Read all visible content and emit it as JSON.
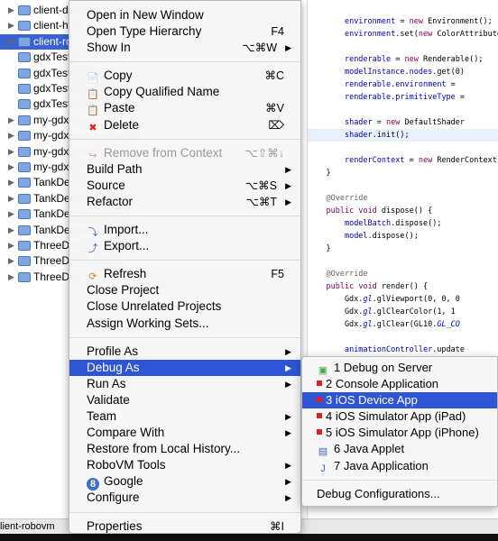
{
  "tree": {
    "items": [
      {
        "label": "client-desktop",
        "arrow": true
      },
      {
        "label": "client-html",
        "arrow": true
      },
      {
        "label": "client-robovm",
        "arrow": true,
        "selected": true
      },
      {
        "label": "gdxTests",
        "arrow": false
      },
      {
        "label": "gdxTests-android",
        "arrow": false
      },
      {
        "label": "gdxTests-desktop",
        "arrow": false
      },
      {
        "label": "gdxTests-html",
        "arrow": false
      },
      {
        "label": "my-gdx-game",
        "arrow": true
      },
      {
        "label": "my-gdx-game-android",
        "arrow": true
      },
      {
        "label": "my-gdx-game-desktop",
        "arrow": true
      },
      {
        "label": "my-gdx-game-html",
        "arrow": true
      },
      {
        "label": "TankDemo",
        "arrow": true
      },
      {
        "label": "TankDemo-android",
        "arrow": true
      },
      {
        "label": "TankDemo-desktop",
        "arrow": true
      },
      {
        "label": "TankDemo-html",
        "arrow": true
      },
      {
        "label": "ThreeDee",
        "arrow": true
      },
      {
        "label": "ThreeDee-android",
        "arrow": true
      },
      {
        "label": "ThreeDee-desktop",
        "arrow": true
      }
    ]
  },
  "editor": {
    "lines": [
      [],
      [
        {
          "t": "        "
        },
        {
          "t": "environment",
          "c": "f"
        },
        {
          "t": " = "
        },
        {
          "t": "new",
          "c": "k"
        },
        {
          "t": " Environment();"
        }
      ],
      [
        {
          "t": "        "
        },
        {
          "t": "environment",
          "c": "f"
        },
        {
          "t": ".set("
        },
        {
          "t": "new",
          "c": "k"
        },
        {
          "t": " ColorAttribute"
        }
      ],
      [],
      [
        {
          "t": "        "
        },
        {
          "t": "renderable",
          "c": "f"
        },
        {
          "t": " = "
        },
        {
          "t": "new",
          "c": "k"
        },
        {
          "t": " Renderable();"
        }
      ],
      [
        {
          "t": "        "
        },
        {
          "t": "modelInstance",
          "c": "f"
        },
        {
          "t": "."
        },
        {
          "t": "nodes",
          "c": "f"
        },
        {
          "t": ".get(0)"
        }
      ],
      [
        {
          "t": "        "
        },
        {
          "t": "renderable",
          "c": "f"
        },
        {
          "t": "."
        },
        {
          "t": "environment",
          "c": "f"
        },
        {
          "t": " = "
        }
      ],
      [
        {
          "t": "        "
        },
        {
          "t": "renderable",
          "c": "f"
        },
        {
          "t": "."
        },
        {
          "t": "primitiveType",
          "c": "f"
        },
        {
          "t": " ="
        }
      ],
      [],
      [
        {
          "t": "        "
        },
        {
          "t": "shader",
          "c": "f"
        },
        {
          "t": " = "
        },
        {
          "t": "new",
          "c": "k"
        },
        {
          "t": " DefaultShader"
        }
      ],
      [
        {
          "t": "        "
        },
        {
          "t": "shader",
          "c": "f"
        },
        {
          "t": ".init();"
        }
      ],
      [],
      [
        {
          "t": "        "
        },
        {
          "t": "renderContext",
          "c": "f"
        },
        {
          "t": " = "
        },
        {
          "t": "new",
          "c": "k"
        },
        {
          "t": " RenderContext"
        }
      ],
      [
        {
          "t": "    }"
        }
      ],
      [],
      [
        {
          "t": "    "
        },
        {
          "t": "@Override",
          "c": "a"
        }
      ],
      [
        {
          "t": "    "
        },
        {
          "t": "public",
          "c": "k"
        },
        {
          "t": " "
        },
        {
          "t": "void",
          "c": "k"
        },
        {
          "t": " dispose() {"
        }
      ],
      [
        {
          "t": "        "
        },
        {
          "t": "modelBatch",
          "c": "f"
        },
        {
          "t": ".dispose();"
        }
      ],
      [
        {
          "t": "        "
        },
        {
          "t": "model",
          "c": "f"
        },
        {
          "t": ".dispose();"
        }
      ],
      [
        {
          "t": "    }"
        }
      ],
      [],
      [
        {
          "t": "    "
        },
        {
          "t": "@Override",
          "c": "a"
        }
      ],
      [
        {
          "t": "    "
        },
        {
          "t": "public",
          "c": "k"
        },
        {
          "t": " "
        },
        {
          "t": "void",
          "c": "k"
        },
        {
          "t": " render() {"
        }
      ],
      [
        {
          "t": "        Gdx."
        },
        {
          "t": "gl",
          "c": "fi"
        },
        {
          "t": ".glViewport(0, 0, 0"
        }
      ],
      [
        {
          "t": "        Gdx."
        },
        {
          "t": "gl",
          "c": "fi"
        },
        {
          "t": ".glClearColor(1, 1"
        }
      ],
      [
        {
          "t": "        Gdx."
        },
        {
          "t": "gl",
          "c": "fi"
        },
        {
          "t": ".glClear(GL10."
        },
        {
          "t": "GL_CO",
          "c": "fi"
        }
      ],
      [],
      [
        {
          "t": "        "
        },
        {
          "t": "animationController",
          "c": "f"
        },
        {
          "t": ".update"
        }
      ]
    ],
    "highlight_line": 10
  },
  "status": {
    "text": "lient-robovm"
  },
  "context_menu": {
    "groups": [
      [
        {
          "label": "Open in New Window"
        },
        {
          "label": "Open Type Hierarchy",
          "shortcut": "F4"
        },
        {
          "label": "Show In",
          "shortcut": "⌥⌘W",
          "submenu": true
        }
      ],
      [
        {
          "label": "Copy",
          "shortcut": "⌘C",
          "icon": "copy-icon"
        },
        {
          "label": "Copy Qualified Name",
          "icon": "copy-qualified-icon"
        },
        {
          "label": "Paste",
          "shortcut": "⌘V",
          "icon": "paste-icon"
        },
        {
          "label": "Delete",
          "shortcut": "⌦",
          "icon": "delete-icon"
        }
      ],
      [
        {
          "label": "Remove from Context",
          "shortcut": "⌥⇧⌘↓",
          "icon": "remove-context-icon",
          "disabled": true
        },
        {
          "label": "Build Path",
          "submenu": true
        },
        {
          "label": "Source",
          "shortcut": "⌥⌘S",
          "submenu": true
        },
        {
          "label": "Refactor",
          "shortcut": "⌥⌘T",
          "submenu": true
        }
      ],
      [
        {
          "label": "Import...",
          "icon": "import-icon"
        },
        {
          "label": "Export...",
          "icon": "export-icon"
        }
      ],
      [
        {
          "label": "Refresh",
          "shortcut": "F5",
          "icon": "refresh-icon"
        },
        {
          "label": "Close Project"
        },
        {
          "label": "Close Unrelated Projects"
        },
        {
          "label": "Assign Working Sets..."
        }
      ],
      [
        {
          "label": "Profile As",
          "submenu": true
        },
        {
          "label": "Debug As",
          "submenu": true,
          "highlighted": true
        },
        {
          "label": "Run As",
          "submenu": true
        },
        {
          "label": "Validate"
        },
        {
          "label": "Team",
          "submenu": true
        },
        {
          "label": "Compare With",
          "submenu": true
        },
        {
          "label": "Restore from Local History..."
        },
        {
          "label": "RoboVM Tools",
          "submenu": true
        },
        {
          "label": "Google",
          "submenu": true,
          "icon": "google-icon"
        },
        {
          "label": "Configure",
          "submenu": true
        }
      ],
      [
        {
          "label": "Properties",
          "shortcut": "⌘I"
        }
      ]
    ]
  },
  "debug_submenu": {
    "items": [
      {
        "label": "1 Debug on Server",
        "icon": "server-icon"
      },
      {
        "label": "2 Console Application",
        "icon": "red-square-icon"
      },
      {
        "label": "3 iOS Device App",
        "icon": "red-square-icon",
        "highlighted": true
      },
      {
        "label": "4 iOS Simulator App (iPad)",
        "icon": "red-square-icon"
      },
      {
        "label": "5 iOS Simulator App (iPhone)",
        "icon": "red-square-icon"
      },
      {
        "label": "6 Java Applet",
        "icon": "applet-icon"
      },
      {
        "label": "7 Java Application",
        "icon": "java-app-icon"
      }
    ],
    "footer": "Debug Configurations..."
  },
  "colors": {
    "highlight": "#2e55d6",
    "selection": "#3a63d0",
    "keyword": "#7f0055",
    "field": "#0000c0"
  }
}
